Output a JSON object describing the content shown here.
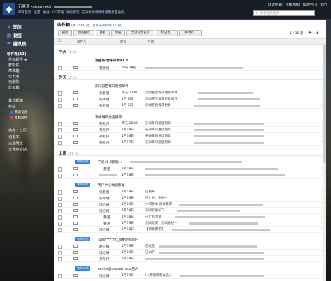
{
  "header": {
    "logo_glyph": "◆",
    "user_name": "万豪盈 <wanyaxin",
    "links": [
      "邮箱首页",
      "设置",
      "换肤",
      "QQ邮箱",
      "微信绑定",
      "在收到新邮件时使用桌面通知。"
    ],
    "right_links": [
      "自动登录",
      "在线客服",
      "帮助中心",
      "退出"
    ],
    "search_placeholder": "邮件全文搜索"
  },
  "nav": {
    "write": "写信",
    "receive": "收信",
    "contacts": "通讯录",
    "folders": [
      {
        "label": "收件箱(11)",
        "current": true
      },
      {
        "label": "星标邮件 ★"
      },
      {
        "label": "群邮件"
      },
      {
        "label": "草稿箱"
      },
      {
        "label": "已发送"
      },
      {
        "label": "已删除"
      },
      {
        "label": "垃圾箱"
      }
    ],
    "other_mailbox": "其他邮箱",
    "tags_label": "标签",
    "tags": [
      {
        "label": "我的信息",
        "color": "#2a7de1"
      },
      {
        "label": "星标邮件",
        "color": "#d24a4a"
      }
    ],
    "apps": [
      "待办",
      "日历",
      "记事本",
      "企业网盘",
      "文件中转站"
    ]
  },
  "inbox": {
    "title": "收件箱",
    "sub": "(共 3586 封，其中",
    "unread_link": "未读邮件 11 封",
    "sub_end": ")",
    "toolbar": [
      "删除",
      "彻底删除",
      "转发",
      "举报",
      "全部标为已读",
      "标记为...",
      "移动到..."
    ],
    "pagination": "1 / 36 页",
    "nav_arrows": [
      "▶",
      "▲"
    ],
    "columns": [
      "发件人",
      "时间",
      "主题"
    ],
    "groups": [
      {
        "id": "today",
        "label": "今天",
        "count": "(1 封)"
      },
      {
        "id": "yesterday",
        "label": "昨天",
        "count": "(2 封)"
      },
      {
        "id": "lastweek",
        "label": "上周",
        "count": "(97 封)"
      }
    ],
    "threads": [
      {
        "title": "酒星条·金牛存案v1.3"
      },
      {
        "title": "测试报告每日更新邮件"
      },
      {
        "title": "安卓每日进度跟踪"
      },
      {
        "tag": "收到的信",
        "title": "广发v1.2新版..."
      },
      {
        "tag": "收到的信",
        "title": "用户中心数据修复"
      },
      {
        "tag": "收到的信",
        "title": "julia*****ng_ls更新到客户"
      },
      {
        "tag": "收到的信",
        "title": "senior@prometheus招人"
      }
    ],
    "rows": [
      {
        "sender": "营收组",
        "time": "43分 钟前",
        "subj": ""
      },
      {
        "sender": "张春丽",
        "time": "昨天 22:00",
        "subj": "测试报告每日更新邮件"
      },
      {
        "sender": "陈雨晴",
        "time": "1月 8日",
        "subj": "测试报告每日更新邮件"
      },
      {
        "sender": "张春丽",
        "time": "1月 6日",
        "subj": "测试报告每日更新"
      },
      {
        "sender": "孙凯伟",
        "time": "昨天 22:00",
        "subj": "安卓每日进度跟踪"
      },
      {
        "sender": "孙凯伟",
        "time": "1月19日",
        "subj": "安卓每日进度跟踪"
      },
      {
        "sender": "孙凯伟",
        "time": "1月18日",
        "subj": "安卓每日进度跟踪"
      },
      {
        "sender": "孙凯伟",
        "time": "1月17日",
        "subj": "安卓每日进度跟踪"
      },
      {
        "sender": "黄涵",
        "time": "1月19日",
        "subj": ""
      },
      {
        "sender": "",
        "time": "1月18日",
        "subj": ""
      },
      {
        "sender": "张春丽",
        "time": "1月19日",
        "subj": "已发布"
      },
      {
        "sender": "陈雨晴",
        "time": "1月19日",
        "subj": "已上线，谢谢~"
      },
      {
        "sender": "冯红梅",
        "time": "1月19日",
        "subj": "中间版本 测试更新"
      },
      {
        "sender": "冯红梅",
        "time": "1月19日",
        "subj": "测试结果如下"
      },
      {
        "sender": "黄涵",
        "time": "1月18日",
        "subj": "已上线测试"
      },
      {
        "sender": "黄涵",
        "time": "1月19日",
        "subj": "测试结果，测试通过~"
      },
      {
        "sender": "冯红梅",
        "time": "1月18日",
        "subj": "【新建需求】"
      },
      {
        "sender": "赵红梅",
        "time": "1月19日",
        "subj": "已处理"
      },
      {
        "sender": "冯红梅",
        "time": "1月19日",
        "subj": "已执行"
      },
      {
        "sender": "孙凯伟",
        "time": "1月19日",
        "subj": ""
      },
      {
        "sender": "冯红梅",
        "time": "1月19日",
        "subj": "Hi 看能有新候选人"
      }
    ]
  }
}
